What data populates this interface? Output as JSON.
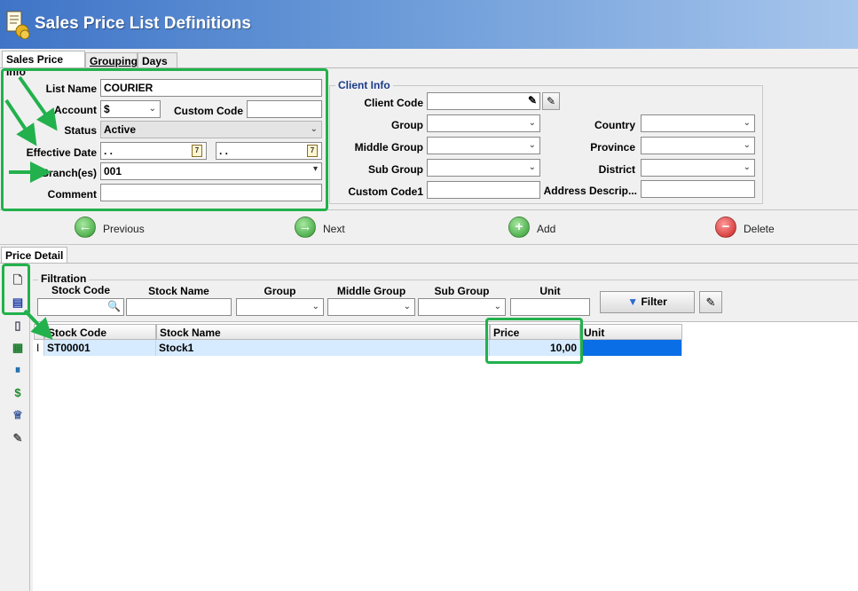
{
  "window": {
    "title": "Sales Price List Definitions",
    "icon": "price-list-icon"
  },
  "tabs": [
    {
      "label": "Sales Price Info",
      "active": true
    },
    {
      "label": "Grouping",
      "active": false
    },
    {
      "label": "Days",
      "active": false
    }
  ],
  "form": {
    "list_name_label": "List Name",
    "list_name_value": "COURIER",
    "account_label": "Account",
    "account_value": "$",
    "custom_code_label": "Custom Code",
    "custom_code_value": "",
    "status_label": "Status",
    "status_value": "Active",
    "effective_date_label": "Effective Date",
    "date_from": ". .",
    "date_to": ". .",
    "branches_label": "Branch(es)",
    "branches_value": "001",
    "comment_label": "Comment",
    "comment_value": ""
  },
  "client_info": {
    "title": "Client Info",
    "client_code_label": "Client Code",
    "group_label": "Group",
    "middle_group_label": "Middle Group",
    "sub_group_label": "Sub Group",
    "custom_code1_label": "Custom Code1",
    "country_label": "Country",
    "province_label": "Province",
    "district_label": "District",
    "address_label": "Address Descrip..."
  },
  "navbar": {
    "previous": "Previous",
    "next": "Next",
    "add": "Add",
    "delete": "Delete"
  },
  "price_detail": {
    "tab_label": "Price Detail",
    "filtration_title": "Filtration",
    "filter_headers": {
      "stock_code": "Stock Code",
      "stock_name": "Stock Name",
      "group": "Group",
      "middle_group": "Middle Group",
      "sub_group": "Sub Group",
      "unit": "Unit"
    },
    "filter_button": "Filter",
    "grid_columns": {
      "stock_code": "Stock Code",
      "stock_name": "Stock Name",
      "price": "Price",
      "unit": "Unit"
    },
    "rows": [
      {
        "marker": "I",
        "stock_code": "ST00001",
        "stock_name": "Stock1",
        "price": "10,00",
        "unit": ""
      }
    ]
  },
  "colors": {
    "annotation_green": "#22b14c",
    "title_bar": "#3f74c7",
    "row_highlight": "#d6ebff",
    "unit_cell": "#0a6ee6"
  }
}
